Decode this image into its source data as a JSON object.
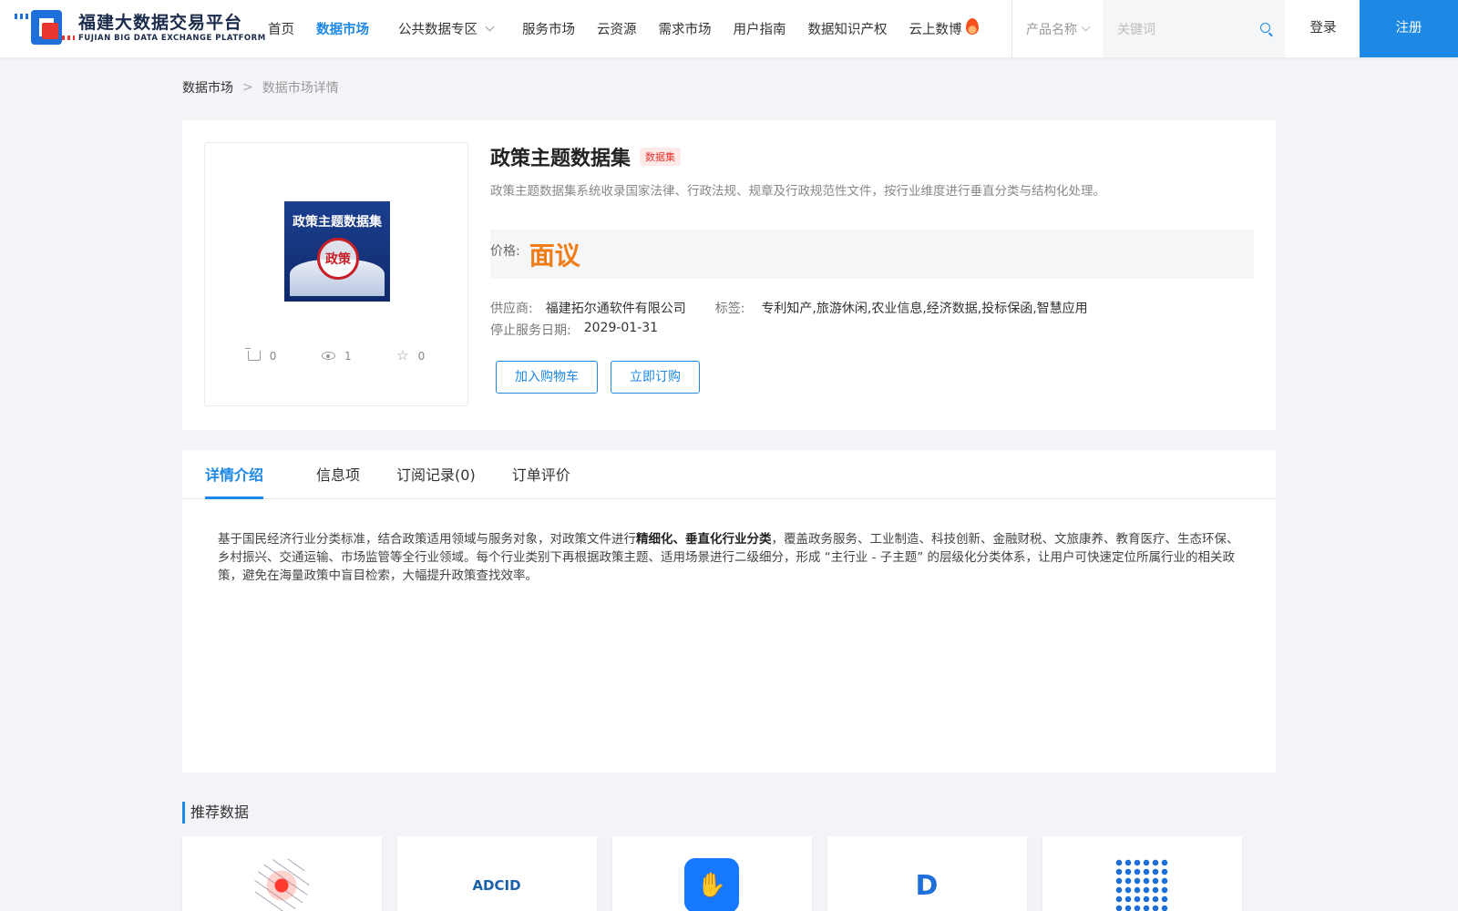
{
  "header": {
    "logo_cn": "福建大数据交易平台",
    "logo_en": "FUJIAN BIG DATA EXCHANGE PLATFORM",
    "nav": [
      "首页",
      "数据市场",
      "公共数据专区",
      "服务市场",
      "云资源",
      "需求市场",
      "用户指南",
      "数据知识产权",
      "云上数博"
    ],
    "active_nav": "数据市场",
    "search_type": "产品名称",
    "search_placeholder": "关键词",
    "login": "登录",
    "register": "注册"
  },
  "breadcrumb": {
    "root": "数据市场",
    "separator": ">",
    "current": "数据市场详情"
  },
  "product": {
    "cover_title": "政策主题数据集",
    "cover_stamp": "政策",
    "title": "政策主题数据集",
    "type_tag": "数据集",
    "description": "政策主题数据集系统收录国家法律、行政法规、规章及行政规范性文件，按行业维度进行垂直分类与结构化处理。",
    "price_label": "价格:",
    "price": "面议",
    "supplier_label": "供应商:",
    "supplier": "福建拓尔通软件有限公司",
    "tags_label": "标签:",
    "tags": "专利知产,旅游休闲,农业信息,经济数据,投标保函,智慧应用",
    "end_date_label": "停止服务日期:",
    "end_date": "2029-01-31",
    "stats": {
      "cart": "0",
      "views": "1",
      "favorites": "0"
    },
    "add_cart": "加入购物车",
    "subscribe": "立即订购"
  },
  "tabs": [
    "详情介绍",
    "信息项",
    "订阅记录(0)",
    "订单评价"
  ],
  "active_tab": "详情介绍",
  "detail": {
    "part1": "基于国民经济行业分类标准，结合政策适用领域与服务对象，对政策文件进行",
    "bold": "精细化、垂直化行业分类",
    "part2": "，覆盖政务服务、工业制造、科技创新、金融财税、文旅康养、教育医疗、生态环保、乡村振兴、交通运输、市场监管等全行业领域。每个行业类别下再根据政策主题、适用场景进行二级细分，形成 “主行业 - 子主题” 的层级化分类体系，让用户可快速定位所属行业的相关政策，避免在海量政策中盲目检索，大幅提升政策查找效率。"
  },
  "recommend": {
    "title": "推荐数据",
    "items": [
      {
        "icon": "network-icon"
      },
      {
        "icon": "adcid-logo",
        "label": "ADCID"
      },
      {
        "icon": "hand-app-icon"
      },
      {
        "icon": "d-logo"
      },
      {
        "icon": "dot-grid-logo"
      }
    ]
  }
}
